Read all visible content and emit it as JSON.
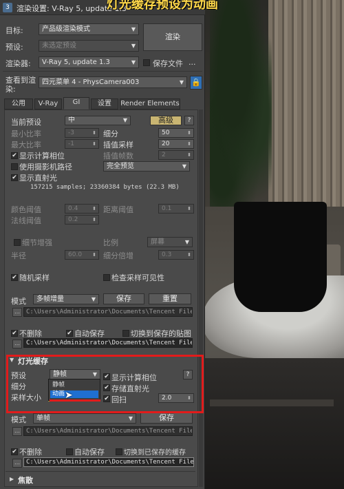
{
  "caption": "灯光缓存预设为动画",
  "window": {
    "title": "渲染设置: V-Ray 5, update 1.3"
  },
  "top": {
    "target_label": "目标:",
    "target_value": "产品级渲染模式",
    "preset_label": "预设:",
    "preset_value": "未选定预设",
    "renderer_label": "渲染器:",
    "renderer_value": "V-Ray 5, update 1.3",
    "save_file_label": "保存文件",
    "save_file_checked": false,
    "more_label": "...",
    "render_button": "渲染",
    "view_label_1": "查看到渲",
    "view_label_2": "染:",
    "view_value": "四元菜单 4 - PhysCamera003",
    "lock_icon": "lock-icon"
  },
  "tabs": [
    "公用",
    "V-Ray",
    "GI",
    "设置",
    "Render Elements"
  ],
  "active_tab": "GI",
  "gi": {
    "current_preset_label": "当前预设",
    "current_preset_value": "中",
    "advanced_button": "高级",
    "help": "?",
    "min_rate_label": "最小比率",
    "min_rate_value": "-3",
    "max_rate_label": "最大比率",
    "max_rate_value": "-1",
    "subdivs_label": "细分",
    "subdivs_value": "50",
    "interp_samples_label": "插值采样",
    "interp_samples_value": "20",
    "interp_frames_label": "插值帧数",
    "interp_frames_value": "2",
    "show_calc_label": "显示计算相位",
    "show_calc_checked": true,
    "use_camera_path_label": "使用摄影机路径",
    "use_camera_path_checked": false,
    "preview_value": "完全预览",
    "show_direct_label": "显示直射光",
    "show_direct_checked": true,
    "stats": "157215 samples; 23360384 bytes (22.3 MB)",
    "color_thresh_label": "颜色阈值",
    "color_thresh_value": "0.4",
    "dist_thresh_label": "距离阈值",
    "dist_thresh_value": "0.1",
    "normal_thresh_label": "法线阈值",
    "normal_thresh_value": "0.2",
    "detail_enhance_label": "细节增强",
    "detail_enhance_checked": false,
    "scale_label": "比例",
    "scale_value": "屏幕",
    "radius_label": "半径",
    "radius_value": "60.0",
    "subdiv_mult_label": "细分倍增",
    "subdiv_mult_value": "0.3",
    "random_samples_label": "随机采样",
    "random_samples_checked": true,
    "check_vis_label": "检查采样可见性",
    "check_vis_checked": false,
    "mode_label": "模式",
    "mode_value": "多帧增量",
    "save_button": "保存",
    "reset_button": "重置",
    "path_1": "C:\\Users\\Administrator\\Documents\\Tencent Files\\",
    "no_delete_label": "不删除",
    "no_delete_checked": true,
    "auto_save_label": "自动保存",
    "auto_save_checked": true,
    "switch_saved_label": "切换到保存的贴图",
    "switch_saved_checked": false,
    "path_2": "C:\\Users\\Administrator\\Documents\\Tencent Files\\"
  },
  "light_cache": {
    "header": "灯光缓存",
    "preset_label": "预设",
    "preset_value": "静帧",
    "subdivs_label": "细分",
    "sample_size_label": "采样大小",
    "show_calc_label": "显示计算相位",
    "show_calc_checked": true,
    "store_direct_label": "存储直射光",
    "store_direct_checked": true,
    "retrace_label": "回扫",
    "retrace_checked": true,
    "retrace_value": "2.0",
    "help": "?",
    "dropdown_options": [
      "静帧",
      "动画"
    ],
    "dropdown_selected": "动画",
    "mode_label": "模式",
    "mode_value": "单帧",
    "save_button": "保存",
    "path_1": "C:\\Users\\Administrator\\Documents\\Tencent Files\\",
    "no_delete_label": "不删除",
    "no_delete_checked": true,
    "auto_save_label": "自动保存",
    "auto_save_checked": false,
    "switch_saved_label": "切换到已保存的缓存",
    "switch_saved_checked": false,
    "path_2": "C:\\Users\\Administrator\\Documents\\Tencent Files\\"
  },
  "caustics": {
    "header": "焦散"
  },
  "colors": {
    "caption": "#ffd84a",
    "highlight_box": "#e21b1b",
    "selection": "#1f6fd1"
  }
}
